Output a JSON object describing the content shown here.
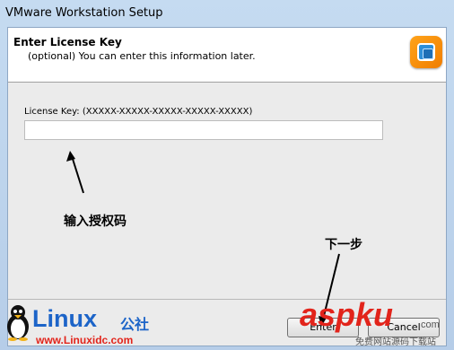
{
  "window": {
    "title": "VMware Workstation Setup"
  },
  "header": {
    "title": "Enter License Key",
    "subtitle": "(optional) You can enter this information later."
  },
  "license": {
    "label": "License Key: (XXXXX-XXXXX-XXXXX-XXXXX-XXXXX)",
    "value": ""
  },
  "annotations": {
    "input_hint": "输入授权码",
    "next_hint": "下一步"
  },
  "buttons": {
    "enter_label": "Enter",
    "cancel_label": "Cancel"
  },
  "watermarks": {
    "linux_logo": "Linux",
    "linux_cn": "公社",
    "linux_url": "www.Linuxidc.com",
    "asp_logo": "aspku",
    "asp_suffix": ".com",
    "asp_sub": "免费网站源码下载站"
  },
  "colors": {
    "accent_red": "#e2241b",
    "vm_orange": "#f08a00",
    "vm_blue": "#2e8fd8"
  }
}
